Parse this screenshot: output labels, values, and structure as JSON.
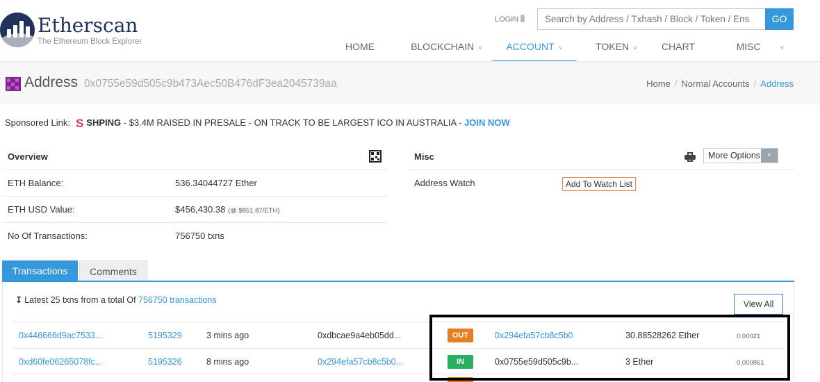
{
  "header": {
    "logo_title": "Etherscan",
    "logo_subtitle": "The Ethereum Block Explorer",
    "login_label": "LOGIN",
    "search_placeholder": "Search by Address / Txhash / Block / Token / Ens",
    "search_button": "GO",
    "nav": [
      {
        "label": "HOME",
        "dropdown": false,
        "active": false
      },
      {
        "label": "BLOCKCHAIN",
        "dropdown": true,
        "active": false
      },
      {
        "label": "ACCOUNT",
        "dropdown": true,
        "active": true
      },
      {
        "label": "TOKEN",
        "dropdown": true,
        "active": false
      },
      {
        "label": "CHART",
        "dropdown": false,
        "active": false
      },
      {
        "label": "MISC",
        "dropdown": true,
        "active": false
      }
    ],
    "caret_glyph": "˅"
  },
  "address_bar": {
    "label": "Address",
    "hash": "0x0755e59d505c9b473Aec50B476dF3ea2045739aa",
    "breadcrumb": [
      "Home",
      "Normal Accounts",
      "Address"
    ],
    "separator": "/"
  },
  "sponsored": {
    "prefix": "Sponsored Link:",
    "logo_letter": "S",
    "brand": "SHPING",
    "text": " - $3.4M RAISED IN PRESALE - ON TRACK TO BE LARGEST ICO IN AUSTRALIA - ",
    "cta": "JOIN NOW"
  },
  "overview": {
    "title": "Overview",
    "rows": [
      {
        "label": "ETH Balance:",
        "value": "536.34044727 Ether",
        "note": ""
      },
      {
        "label": "ETH USD Value:",
        "value": "$456,430.38",
        "note": "(@ $851.87/ETH)"
      },
      {
        "label": "No Of Transactions:",
        "value": "756750 txns",
        "note": ""
      }
    ]
  },
  "misc": {
    "title": "Misc",
    "more_options": "More Options",
    "more_options_caret": "˅",
    "address_watch_label": "Address Watch",
    "watch_button": "Add To Watch List"
  },
  "tabs": {
    "transactions": "Transactions",
    "comments": "Comments"
  },
  "transactions": {
    "summary_prefix": "Latest 25 txns from a total Of ",
    "summary_link": "756750 transactions",
    "view_all": "View All",
    "rows": [
      {
        "txhash": "0x446666d9ac7533...",
        "block": "5195329",
        "age": "3 mins ago",
        "from": "0xdbcae9a4eb05dd...",
        "from_is_link": false,
        "direction": "OUT",
        "to": "0x294efa57cb8c5b0",
        "to_is_link": true,
        "value": "30.88528262 Ether",
        "fee": "0.00021"
      },
      {
        "txhash": "0xd60fe06265078fc...",
        "block": "5195326",
        "age": "8 mins ago",
        "from": "0x294efa57cb8c5b0...",
        "from_is_link": true,
        "direction": "IN",
        "to": "0x0755e59d505c9b...",
        "to_is_link": false,
        "value": "3 Ether",
        "fee": "0.000861"
      }
    ]
  },
  "colors": {
    "accent": "#3498db",
    "out_badge": "#e67e22",
    "in_badge": "#27ae60",
    "logo_dark": "#21325b"
  }
}
